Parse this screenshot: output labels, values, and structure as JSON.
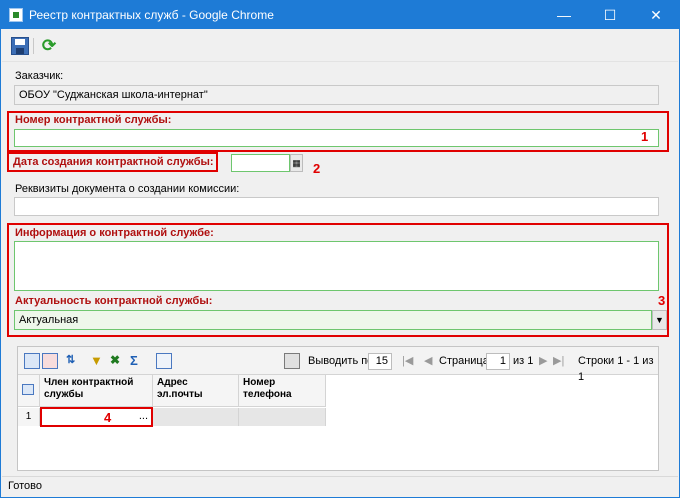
{
  "window": {
    "title": "Реестр контрактных служб - Google Chrome"
  },
  "form": {
    "customer_label": "Заказчик:",
    "customer_value": "ОБОУ \"Суджанская школа-интернат\"",
    "number_label": "Номер контрактной службы:",
    "number_value": "",
    "date_label": "Дата создания контрактной службы:",
    "date_value": "",
    "requisites_label": "Реквизиты документа о создании комиссии:",
    "requisites_value": "",
    "info_label": "Информация о контрактной службе:",
    "info_value": "",
    "actuality_label": "Актуальность контрактной службы:",
    "actuality_value": "Актуальная"
  },
  "annotations": [
    "1",
    "2",
    "3",
    "4"
  ],
  "grid": {
    "per_page_label": "Выводить по",
    "per_page_value": "15",
    "page_label": "Страница",
    "page_value": "1",
    "of_label": "из 1",
    "rows_label": "Строки 1 - 1 из 1",
    "columns": [
      "Член контрактной службы",
      "Адрес эл.почты",
      "Номер телефона"
    ],
    "rows": [
      {
        "num": "1",
        "member": "...",
        "email": "",
        "phone": ""
      }
    ]
  },
  "status": {
    "text": "Готово"
  },
  "colors": {
    "titlebar": "#1e7bd6",
    "required_label": "#b01010",
    "highlight": "#e00000",
    "required_border": "#6ec66e"
  }
}
